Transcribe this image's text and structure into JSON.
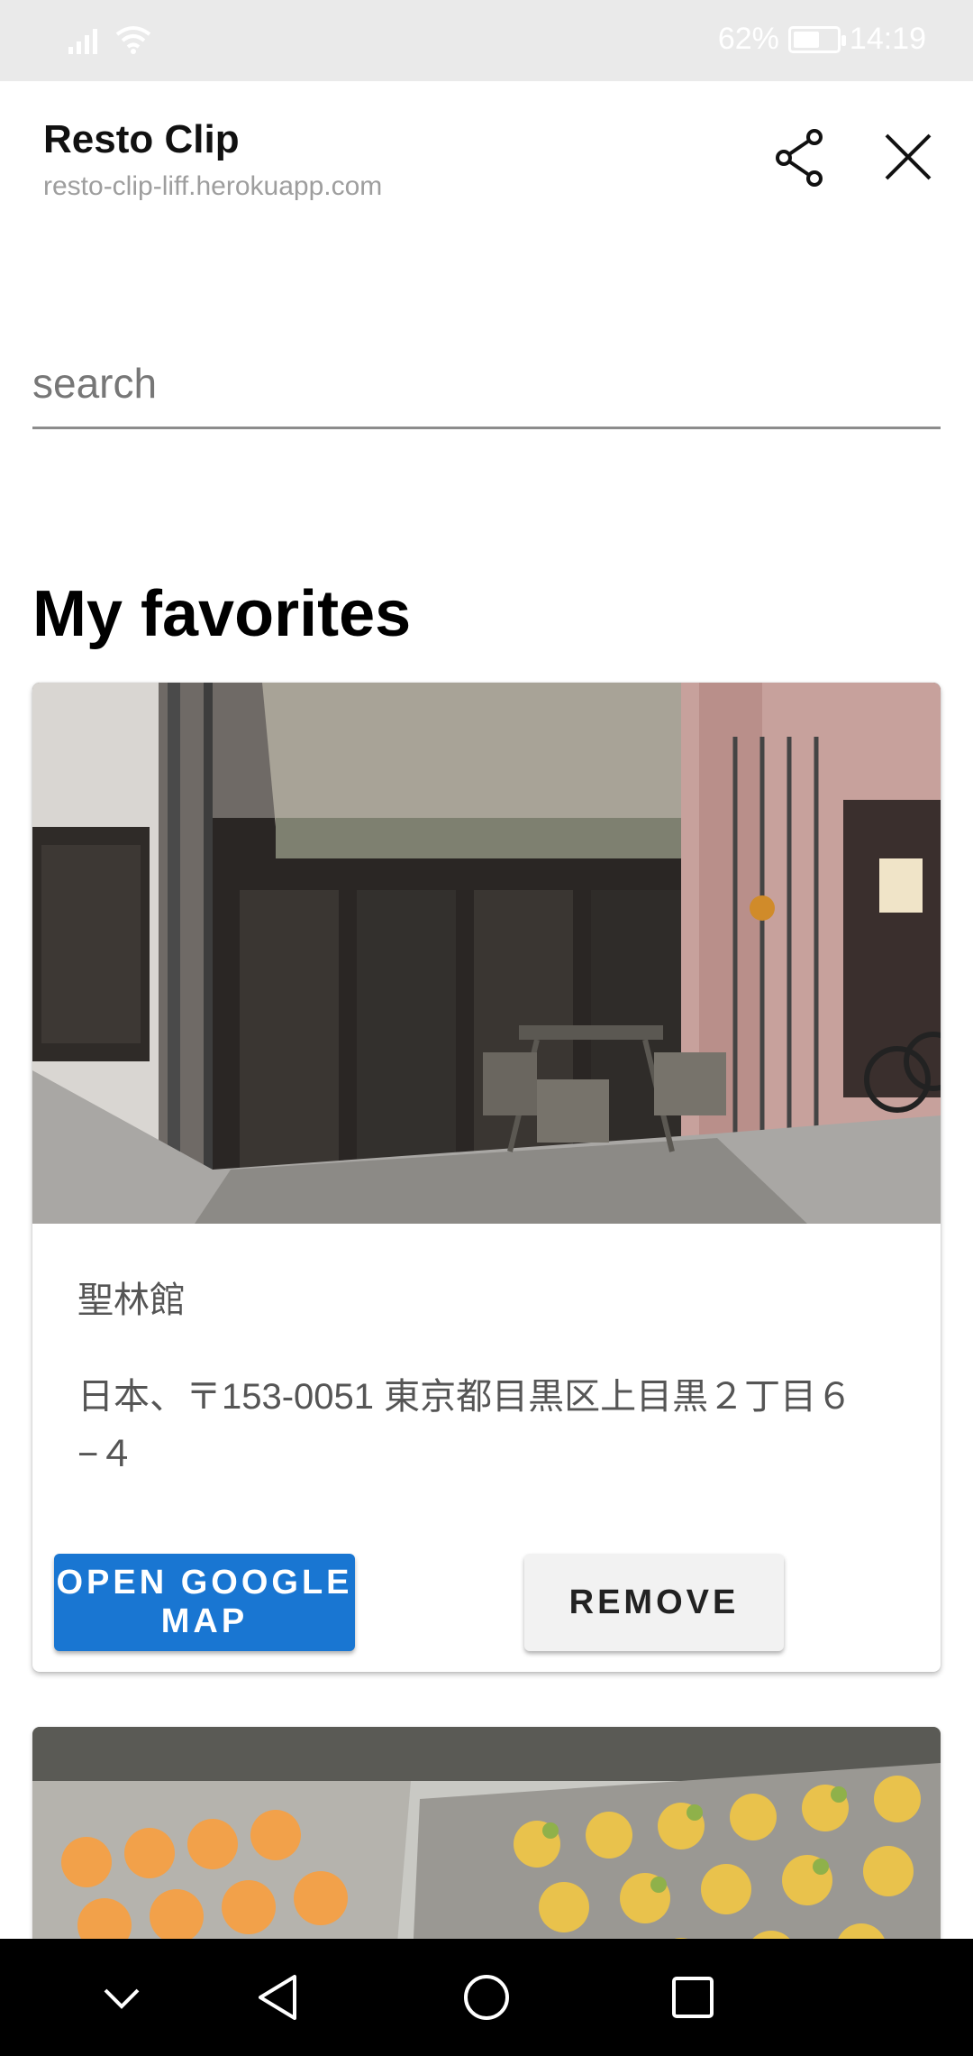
{
  "status_bar": {
    "battery": "62%",
    "battery_level": 0.62,
    "time": "14:19"
  },
  "header": {
    "title": "Resto Clip",
    "url": "resto-clip-liff.herokuapp.com",
    "share_icon": "share-icon",
    "close_icon": "close-icon"
  },
  "search": {
    "placeholder": "search",
    "value": ""
  },
  "section": {
    "title": "My favorites"
  },
  "favorites": [
    {
      "name": "聖林館",
      "address": "日本、〒153-0051 東京都目黒区上目黒２丁目６−４",
      "open_map_label": "OPEN GOOGLE MAP",
      "remove_label": "REMOVE"
    }
  ],
  "colors": {
    "primary": "#1976d2",
    "status_bar_bg": "#eaeaea",
    "nav_bar_bg": "#000000"
  },
  "nav_bar": {
    "icons": [
      "chevron-down-icon",
      "back-icon",
      "home-icon",
      "recents-icon"
    ]
  }
}
